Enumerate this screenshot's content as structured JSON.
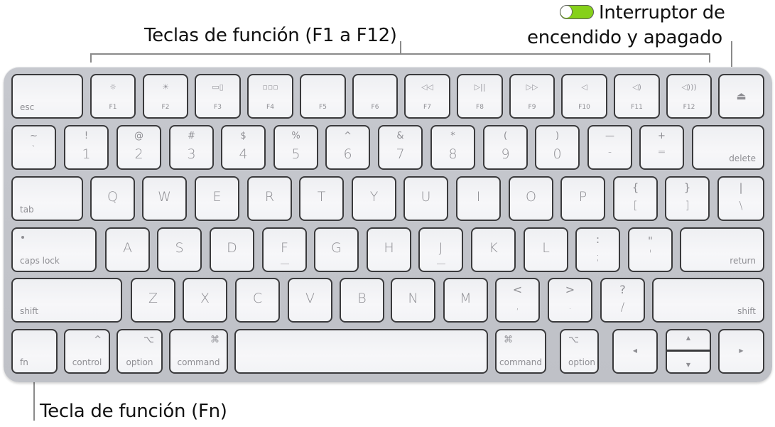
{
  "callouts": {
    "function_keys": "Teclas de función (F1 a F12)",
    "power_switch_line1": "Interruptor de",
    "power_switch_line2": "encendido y apagado",
    "fn_key": "Tecla de función (Fn)"
  },
  "power_switch": {
    "state": "on",
    "color": "#86d11a"
  },
  "colors": {
    "frame": "#c4c6cc",
    "key": "#f4f4f6",
    "key_border": "#3a3a3c",
    "legend": "#8e8e93"
  },
  "keys": {
    "esc": "esc",
    "f1": {
      "icon": "☼",
      "label": "F1"
    },
    "f2": {
      "icon": "☀",
      "label": "F2"
    },
    "f3": {
      "icon": "▭▯",
      "label": "F3"
    },
    "f4": {
      "icon": "▫▫▫",
      "label": "F4"
    },
    "f5": {
      "label": "F5"
    },
    "f6": {
      "label": "F6"
    },
    "f7": {
      "icon": "◁◁",
      "label": "F7"
    },
    "f8": {
      "icon": "▷||",
      "label": "F8"
    },
    "f9": {
      "icon": "▷▷",
      "label": "F9"
    },
    "f10": {
      "icon": "◁",
      "label": "F10"
    },
    "f11": {
      "icon": "◁)",
      "label": "F11"
    },
    "f12": {
      "icon": "◁)))",
      "label": "F12"
    },
    "eject": "⏏",
    "row2": [
      {
        "top": "~",
        "bot": "`"
      },
      {
        "top": "!",
        "bot": "1"
      },
      {
        "top": "@",
        "bot": "2"
      },
      {
        "top": "#",
        "bot": "3"
      },
      {
        "top": "$",
        "bot": "4"
      },
      {
        "top": "%",
        "bot": "5"
      },
      {
        "top": "^",
        "bot": "6"
      },
      {
        "top": "&",
        "bot": "7"
      },
      {
        "top": "*",
        "bot": "8"
      },
      {
        "top": "(",
        "bot": "9"
      },
      {
        "top": ")",
        "bot": "0"
      },
      {
        "top": "—",
        "bot": "-"
      },
      {
        "top": "+",
        "bot": "="
      }
    ],
    "delete": "delete",
    "tab": "tab",
    "row3": [
      "Q",
      "W",
      "E",
      "R",
      "T",
      "Y",
      "U",
      "I",
      "O",
      "P"
    ],
    "row3_dual": [
      {
        "top": "{",
        "bot": "["
      },
      {
        "top": "}",
        "bot": "]"
      },
      {
        "top": "|",
        "bot": "\\"
      }
    ],
    "caps_lock": "caps lock",
    "row4": [
      "A",
      "S",
      "D",
      "F",
      "G",
      "H",
      "J",
      "K",
      "L"
    ],
    "row4_dual": [
      {
        "top": ":",
        "bot": ";"
      },
      {
        "top": "\"",
        "bot": "'"
      }
    ],
    "return": "return",
    "shift_left": "shift",
    "row5": [
      "Z",
      "X",
      "C",
      "V",
      "B",
      "N",
      "M"
    ],
    "row5_dual": [
      {
        "top": "<",
        "bot": ","
      },
      {
        "top": ">",
        "bot": "."
      },
      {
        "top": "?",
        "bot": "/"
      }
    ],
    "shift_right": "shift",
    "fn": "fn",
    "control": {
      "label": "control",
      "symbol": "^"
    },
    "option_left": {
      "label": "option",
      "symbol": "⌥"
    },
    "command_left": {
      "label": "command",
      "symbol": "⌘"
    },
    "command_right": {
      "label": "command",
      "symbol": "⌘"
    },
    "option_right": {
      "label": "option",
      "symbol": "⌥"
    },
    "arrow_left": "◀",
    "arrow_up": "▲",
    "arrow_down": "▼",
    "arrow_right": "▶"
  }
}
